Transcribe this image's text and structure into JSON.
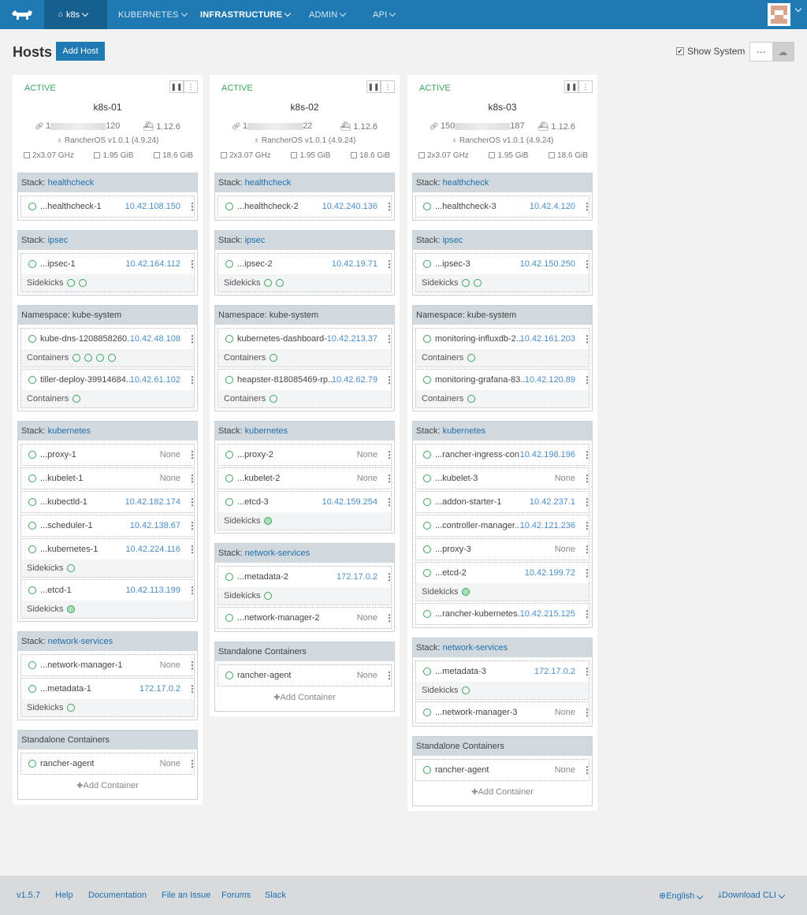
{
  "nav": {
    "env_label": "k8s",
    "items": [
      {
        "label": "KUBERNETES",
        "active": false
      },
      {
        "label": "INFRASTRUCTURE",
        "active": true
      },
      {
        "label": "ADMIN",
        "active": false
      },
      {
        "label": "API",
        "active": false
      }
    ]
  },
  "page": {
    "title": "Hosts",
    "add_host_label": "Add Host",
    "show_system_label": "Show System",
    "show_system_checked": true,
    "view_list_icon": "⋯",
    "view_grid_icon": "☁"
  },
  "hosts": [
    {
      "state": "ACTIVE",
      "name": "k8s-01",
      "ip_suffix": "120",
      "ip_prefix": "1",
      "docker": "1.12.6",
      "os": "RancherOS v1.0.1 (4.9.24)",
      "cpu": "2x3.07 GHz",
      "mem": "1.95 GiB",
      "disk": "18.6 GiB",
      "stacks": [
        {
          "prefix": "Stack:",
          "name": "healthcheck",
          "containers": [
            {
              "name": "...healthcheck-1",
              "ip": "10.42.108.150"
            }
          ]
        },
        {
          "prefix": "Stack:",
          "name": "ipsec",
          "containers": [
            {
              "name": "...ipsec-1",
              "ip": "10.42.164.112",
              "sub_label": "Sidekicks",
              "sub_count": 2
            }
          ]
        },
        {
          "prefix": "Namespace: kube-system",
          "name": "",
          "containers": [
            {
              "name": "kube-dns-1208858260...",
              "ip": "10.42.48.108",
              "sub_label": "Containers",
              "sub_count": 4
            },
            {
              "name": "tiller-deploy-39914684...",
              "ip": "10.42.61.102",
              "sub_label": "Containers",
              "sub_count": 1
            }
          ]
        },
        {
          "prefix": "Stack:",
          "name": "kubernetes",
          "containers": [
            {
              "name": "...proxy-1",
              "ip": "None"
            },
            {
              "name": "...kubelet-1",
              "ip": "None"
            },
            {
              "name": "...kubectld-1",
              "ip": "10.42.182.174"
            },
            {
              "name": "...scheduler-1",
              "ip": "10.42.138.67"
            },
            {
              "name": "...kubernetes-1",
              "ip": "10.42.224.116",
              "sub_label": "Sidekicks",
              "sub_count": 1
            },
            {
              "name": "...etcd-1",
              "ip": "10.42.113.199",
              "sub_label": "Sidekicks",
              "sub_count": 1,
              "sub_filled": true
            }
          ]
        },
        {
          "prefix": "Stack:",
          "name": "network-services",
          "containers": [
            {
              "name": "...network-manager-1",
              "ip": "None"
            },
            {
              "name": "...metadata-1",
              "ip": "172.17.0.2",
              "sub_label": "Sidekicks",
              "sub_count": 1
            }
          ]
        },
        {
          "prefix": "Standalone Containers",
          "name": "",
          "containers": [
            {
              "name": "rancher-agent",
              "ip": "None"
            }
          ],
          "add_label": "Add Container"
        }
      ]
    },
    {
      "state": "ACTIVE",
      "name": "k8s-02",
      "ip_suffix": "22",
      "ip_prefix": "1",
      "docker": "1.12.6",
      "os": "RancherOS v1.0.1 (4.9.24)",
      "cpu": "2x3.07 GHz",
      "mem": "1.95 GiB",
      "disk": "18.6 GiB",
      "stacks": [
        {
          "prefix": "Stack:",
          "name": "healthcheck",
          "containers": [
            {
              "name": "...healthcheck-2",
              "ip": "10.42.240.136"
            }
          ]
        },
        {
          "prefix": "Stack:",
          "name": "ipsec",
          "containers": [
            {
              "name": "...ipsec-2",
              "ip": "10.42.19.71",
              "sub_label": "Sidekicks",
              "sub_count": 2
            }
          ]
        },
        {
          "prefix": "Namespace: kube-system",
          "name": "",
          "containers": [
            {
              "name": "kubernetes-dashboard-...",
              "ip": "10.42.213.37",
              "sub_label": "Containers",
              "sub_count": 1
            },
            {
              "name": "heapster-818085469-rp...",
              "ip": "10.42.62.79",
              "sub_label": "Containers",
              "sub_count": 1
            }
          ]
        },
        {
          "prefix": "Stack:",
          "name": "kubernetes",
          "containers": [
            {
              "name": "...proxy-2",
              "ip": "None"
            },
            {
              "name": "...kubelet-2",
              "ip": "None"
            },
            {
              "name": "...etcd-3",
              "ip": "10.42.159.254",
              "sub_label": "Sidekicks",
              "sub_count": 1,
              "sub_filled": true
            }
          ]
        },
        {
          "prefix": "Stack:",
          "name": "network-services",
          "containers": [
            {
              "name": "...metadata-2",
              "ip": "172.17.0.2",
              "sub_label": "Sidekicks",
              "sub_count": 1
            },
            {
              "name": "...network-manager-2",
              "ip": "None"
            }
          ]
        },
        {
          "prefix": "Standalone Containers",
          "name": "",
          "containers": [
            {
              "name": "rancher-agent",
              "ip": "None"
            }
          ],
          "add_label": "Add Container"
        }
      ]
    },
    {
      "state": "ACTIVE",
      "name": "k8s-03",
      "ip_suffix": "187",
      "ip_prefix": "150",
      "docker": "1.12.6",
      "os": "RancherOS v1.0.1 (4.9.24)",
      "cpu": "2x3.07 GHz",
      "mem": "1.95 GiB",
      "disk": "18.6 GiB",
      "stacks": [
        {
          "prefix": "Stack:",
          "name": "healthcheck",
          "containers": [
            {
              "name": "...healthcheck-3",
              "ip": "10.42.4.120"
            }
          ]
        },
        {
          "prefix": "Stack:",
          "name": "ipsec",
          "containers": [
            {
              "name": "...ipsec-3",
              "ip": "10.42.150.250",
              "sub_label": "Sidekicks",
              "sub_count": 2
            }
          ]
        },
        {
          "prefix": "Namespace: kube-system",
          "name": "",
          "containers": [
            {
              "name": "monitoring-influxdb-2...",
              "ip": "10.42.161.203",
              "sub_label": "Containers",
              "sub_count": 1
            },
            {
              "name": "monitoring-grafana-83...",
              "ip": "10.42.120.89",
              "sub_label": "Containers",
              "sub_count": 1
            }
          ]
        },
        {
          "prefix": "Stack:",
          "name": "kubernetes",
          "containers": [
            {
              "name": "...rancher-ingress-con...",
              "ip": "10.42.198.196"
            },
            {
              "name": "...kubelet-3",
              "ip": "None"
            },
            {
              "name": "...addon-starter-1",
              "ip": "10.42.237.1"
            },
            {
              "name": "...controller-manager...",
              "ip": "10.42.121.236"
            },
            {
              "name": "...proxy-3",
              "ip": "None"
            },
            {
              "name": "...etcd-2",
              "ip": "10.42.199.72",
              "sub_label": "Sidekicks",
              "sub_count": 1,
              "sub_filled": true
            },
            {
              "name": "...rancher-kubernetes...",
              "ip": "10.42.215.125"
            }
          ]
        },
        {
          "prefix": "Stack:",
          "name": "network-services",
          "containers": [
            {
              "name": "...metadata-3",
              "ip": "172.17.0.2",
              "sub_label": "Sidekicks",
              "sub_count": 1
            },
            {
              "name": "...network-manager-3",
              "ip": "None"
            }
          ]
        },
        {
          "prefix": "Standalone Containers",
          "name": "",
          "containers": [
            {
              "name": "rancher-agent",
              "ip": "None"
            }
          ],
          "add_label": "Add Container"
        }
      ]
    }
  ],
  "footer": {
    "version": "v1.5.7",
    "links": [
      "Help",
      "Documentation",
      "File an Issue",
      "Forums",
      "Slack"
    ],
    "language": "English",
    "download": "Download CLI"
  },
  "colors": {
    "nav_bg": "#1f79b3",
    "active_green": "#3da55d",
    "link_blue": "#1f6fab"
  }
}
